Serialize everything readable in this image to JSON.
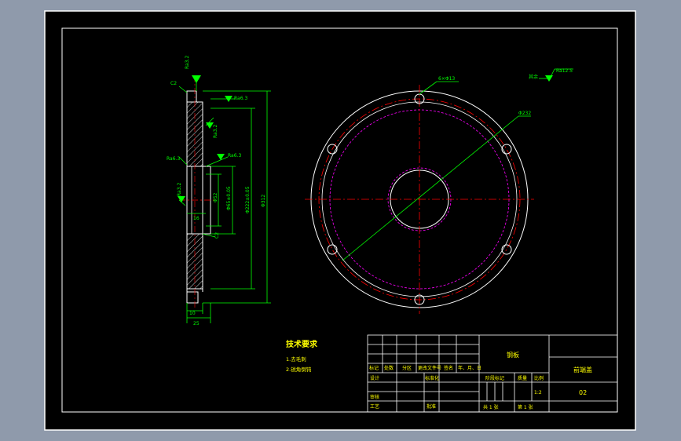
{
  "drawing": {
    "background": "#000000",
    "line_color": "#ffffff",
    "dim_color": "#00ff00",
    "center_color": "#ff0000",
    "hidden_color": "#ff00ff",
    "section_view": {
      "roughness_top": "Ra3.2",
      "chamfer_label": "C2",
      "roughness_face": "Ra3.2",
      "roughness_side": "Ra3.2",
      "roughness_bore": "Ra6.3",
      "roughness_left": "Ra6.3",
      "roughness_left2": "Ra3.2",
      "dim_d1": "Φ52",
      "dim_d2": "Φ65±0.05",
      "dim_d3": "Φ222±0.05",
      "dim_d4": "Φ312",
      "dim_w1": "10",
      "dim_w2": "25",
      "dim_w3": "16",
      "chamfer_bottom": "C2"
    },
    "front_view": {
      "holes_label": "6×Φ13",
      "diameter_label": "Φ232",
      "other_label": "其余",
      "other_roughness": "Ra12.5"
    },
    "notes": {
      "title": "技术要求",
      "lines": [
        "1.去毛刺",
        "2.锐角倒钝"
      ]
    },
    "title_block": {
      "material": "钢板",
      "part_name": "前端盖",
      "drawing_no": "02",
      "scale_label": "比例",
      "scale_value": "1:2",
      "mass_label": "质量",
      "stage_label": "阶段标记",
      "row_labels": [
        "标记",
        "处数",
        "分区",
        "更改文件号",
        "签名",
        "年、月、日"
      ],
      "design": "设计",
      "standard": "标准化",
      "review": "审核",
      "process": "工艺",
      "approve": "批准",
      "sheet_total": "共  1  张",
      "sheet_no": "第  1  张"
    }
  }
}
